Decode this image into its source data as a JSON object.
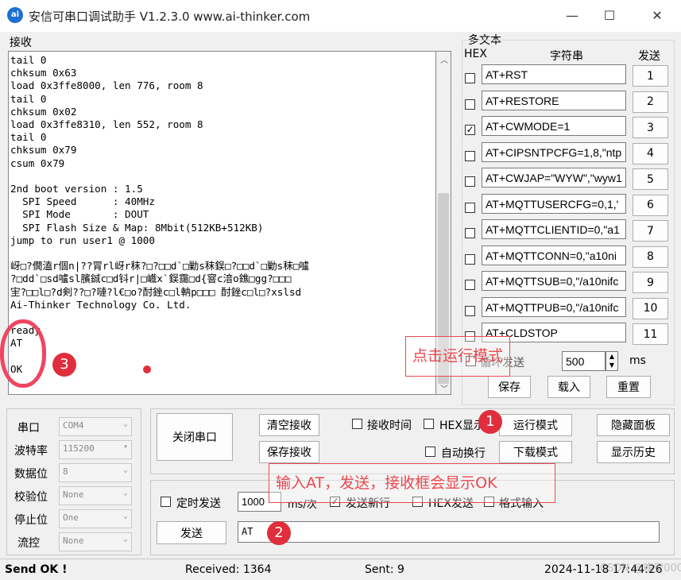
{
  "window": {
    "title": "安信可串口调试助手 V1.2.3.0    www.ai-thinker.com",
    "app_icon_text": "ai",
    "minimize": "—",
    "maximize": "☐",
    "close": "✕"
  },
  "receive": {
    "label": "接收",
    "text": "tail 0\nchksum 0x63\nload 0x3ffe8000, len 776, room 8\ntail 0\nchksum 0x02\nload 0x3ffe8310, len 552, room 8\ntail 0\nchksum 0x79\ncsum 0x79\n\n2nd boot version : 1.5\n  SPI Speed      : 40MHz\n  SPI Mode       : DOUT\n  SPI Flash Size & Map: 8Mbit(512KB+512KB)\njump to run user1 @ 1000\n\n岈□?僩溘r個n|??冐rl岈r秣?□?□□d`□勦s秣鋘□?□□d`□勦s秣□嚧\n?□dd`□sd嚧sl臏鋮c□d钭r|□巇x`鋘靄□d{窨c湆o鐎□gg?□□□\n宔?□□l□?d剣??□?嗹?l€□o?酎銼c□l軜p□□□ 酎銼c□l□?xslsd\nAi-Thinker Technology Co. Ltd.\n\nready\nAT\n\nOK"
  },
  "multi_text": {
    "group_label": "多文本",
    "hex_header": "HEX",
    "string_header": "字符串",
    "send_header": "发送",
    "rows": [
      {
        "checked": false,
        "value": "AT+RST",
        "button": "1"
      },
      {
        "checked": false,
        "value": "AT+RESTORE",
        "button": "2"
      },
      {
        "checked": true,
        "value": "AT+CWMODE=1",
        "button": "3"
      },
      {
        "checked": false,
        "value": "AT+CIPSNTPCFG=1,8,\"ntp",
        "button": "4"
      },
      {
        "checked": false,
        "value": "AT+CWJAP=\"WYW\",\"wyw1",
        "button": "5"
      },
      {
        "checked": false,
        "value": "AT+MQTTUSERCFG=0,1,'",
        "button": "6"
      },
      {
        "checked": false,
        "value": "AT+MQTTCLIENTID=0,\"a1",
        "button": "7"
      },
      {
        "checked": false,
        "value": "AT+MQTTCONN=0,\"a10ni",
        "button": "8"
      },
      {
        "checked": false,
        "value": "AT+MQTTSUB=0,\"/a10nifc",
        "button": "9"
      },
      {
        "checked": false,
        "value": "AT+MQTTPUB=0,\"/a10nifc",
        "button": "10"
      },
      {
        "checked": false,
        "value": "AT+CLDSTOP",
        "button": "11"
      }
    ],
    "loop_send_label": "循环发送",
    "loop_interval": "500",
    "interval_unit": "ms",
    "save_button": "保存",
    "load_button": "载入",
    "reset_button": "重置"
  },
  "serial": {
    "port_label": "串口",
    "port_value": "COM4",
    "baud_label": "波特率",
    "baud_value": "115200",
    "data_bits_label": "数据位",
    "data_bits_value": "8",
    "parity_label": "校验位",
    "parity_value": "None",
    "stop_bits_label": "停止位",
    "stop_bits_value": "One",
    "flow_label": "流控",
    "flow_value": "None"
  },
  "controls": {
    "close_port": "关闭串口",
    "clear_receive": "清空接收",
    "save_receive": "保存接收",
    "receive_time": "接收时间",
    "hex_display": "HEX显示",
    "run_mode": "运行模式",
    "hide_panel": "隐藏面板",
    "auto_wrap": "自动换行",
    "download_mode": "下载模式",
    "show_history": "显示历史"
  },
  "send": {
    "timed_send": "定时发送",
    "interval_value": "1000",
    "interval_unit": "ms/次",
    "send_newline": "发送新行",
    "send_newline_checked": true,
    "hex_send": "HEX发送",
    "format_input": "格式输入",
    "send_button": "发送",
    "send_text": "AT"
  },
  "annotations": {
    "run_mode_note": "点击运行模式",
    "send_note": "输入AT，发送，接收框会显示OK",
    "badge1": "1",
    "badge2": "2",
    "badge3": "3"
  },
  "status": {
    "message": "Send OK !",
    "received": "Received: 1364",
    "sent": "Sent: 9",
    "datetime": "2024-11-18 17:44:26",
    "watermark": "CSDN @晚安000"
  },
  "colors": {
    "annotation_red": "#e8494f",
    "badge_red": "#e02e3c"
  }
}
